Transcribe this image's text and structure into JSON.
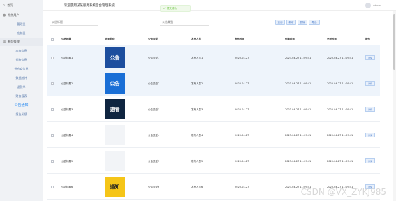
{
  "sidebar": {
    "home_label": "首页",
    "home_sub": "欢迎",
    "section_user": "系统用户",
    "user_items": [
      "管理员",
      "店铺员"
    ],
    "section_module": "模块管理",
    "module_items": [
      "库存信息",
      "销售信息",
      "供应商信息",
      "数据统计",
      "退款单",
      "财务报表",
      "公告通知",
      "报告反馈"
    ],
    "active_index": 6
  },
  "header": {
    "title": "欢迎使用某某服务系统后台管理系统",
    "user": "admin"
  },
  "toast": {
    "text": "提交成功"
  },
  "filters": {
    "title_placeholder": "公告标题",
    "type_placeholder": "公告类型"
  },
  "buttons": [
    "查询",
    "新增",
    "删除",
    "导出"
  ],
  "table": {
    "columns": [
      "公告标题",
      "封面图片",
      "公告类型",
      "发布人员",
      "发布时间",
      "创建时间",
      "更新时间",
      "操作"
    ],
    "rows": [
      {
        "title": "公告标题1",
        "image": "公告",
        "type": "公告类型1",
        "publisher": "发布人员1",
        "date": "2023-04-27",
        "created": "2023-04-27 11:09:41",
        "updated": "2023-04-27 11:09:41",
        "action": "详情"
      },
      {
        "title": "公告标题2",
        "image": "公告",
        "type": "公告类型2",
        "publisher": "发布人员2",
        "date": "2023-04-27",
        "created": "2023-04-27 11:09:41",
        "updated": "2023-04-27 11:09:41",
        "action": "详情"
      },
      {
        "title": "公告标题3",
        "image": "速看",
        "type": "公告类型3",
        "publisher": "发布人员3",
        "date": "2023-04-27",
        "created": "2023-04-27 11:09:41",
        "updated": "2023-04-27 11:09:41",
        "action": "详情"
      },
      {
        "title": "公告标题4",
        "image": "",
        "type": "公告类型4",
        "publisher": "发布人员4",
        "date": "2023-04-27",
        "created": "2023-04-27 11:09:41",
        "updated": "2023-04-27 11:09:41",
        "action": "详情"
      },
      {
        "title": "公告标题5",
        "image": "",
        "type": "公告类型5",
        "publisher": "发布人员5",
        "date": "2023-04-27",
        "created": "2023-04-27 11:09:41",
        "updated": "2023-04-27 11:09:41",
        "action": "详情"
      },
      {
        "title": "公告标题6",
        "image": "通知",
        "type": "公告类型6",
        "publisher": "发布人员6",
        "date": "2023-04-27",
        "created": "2023-04-27 11:09:41",
        "updated": "2023-04-27 11:09:41",
        "action": "详情"
      }
    ]
  },
  "watermark": "CSDN @VX_ZYKJ985",
  "colors": {
    "accent": "#2d8cf0",
    "sidebar_bg": "#f0f2f5",
    "row_highlight": "#eef4fb"
  }
}
